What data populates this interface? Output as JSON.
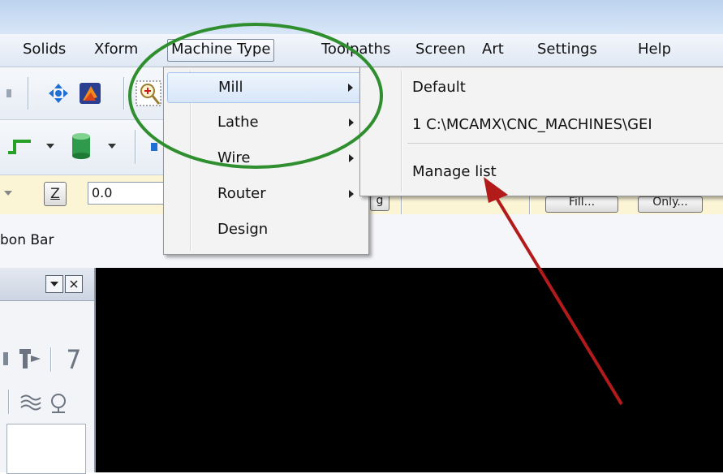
{
  "menubar": {
    "items": [
      {
        "label": "Solids"
      },
      {
        "label": "Xform"
      },
      {
        "label": "Machine Type"
      },
      {
        "label": "Toolpaths"
      },
      {
        "label": "Screen"
      },
      {
        "label": "Art"
      },
      {
        "label": "Settings"
      },
      {
        "label": "Help"
      }
    ],
    "active_index": 2
  },
  "machine_type_menu": {
    "items": [
      {
        "label": "Mill",
        "has_submenu": true,
        "highlighted": true
      },
      {
        "label": "Lathe",
        "has_submenu": true
      },
      {
        "label": "Wire",
        "has_submenu": true
      },
      {
        "label": "Router",
        "has_submenu": true
      },
      {
        "label": "Design",
        "has_submenu": false
      }
    ]
  },
  "mill_submenu": {
    "items": [
      {
        "label": "Default"
      },
      {
        "label": "1  C:\\MCAMX\\CNC_MACHINES\\GEI"
      },
      {
        "label": "Manage list"
      }
    ]
  },
  "ribbon": {
    "z_label": "Z",
    "z_value": "0.0",
    "btn_a": "g",
    "btn_b": "Fill...",
    "btn_c": "Only..."
  },
  "status": {
    "text": "bon Bar"
  },
  "annotations": {
    "ellipse_color": "#2f8f2f",
    "arrow_color": "#b31b1b"
  }
}
